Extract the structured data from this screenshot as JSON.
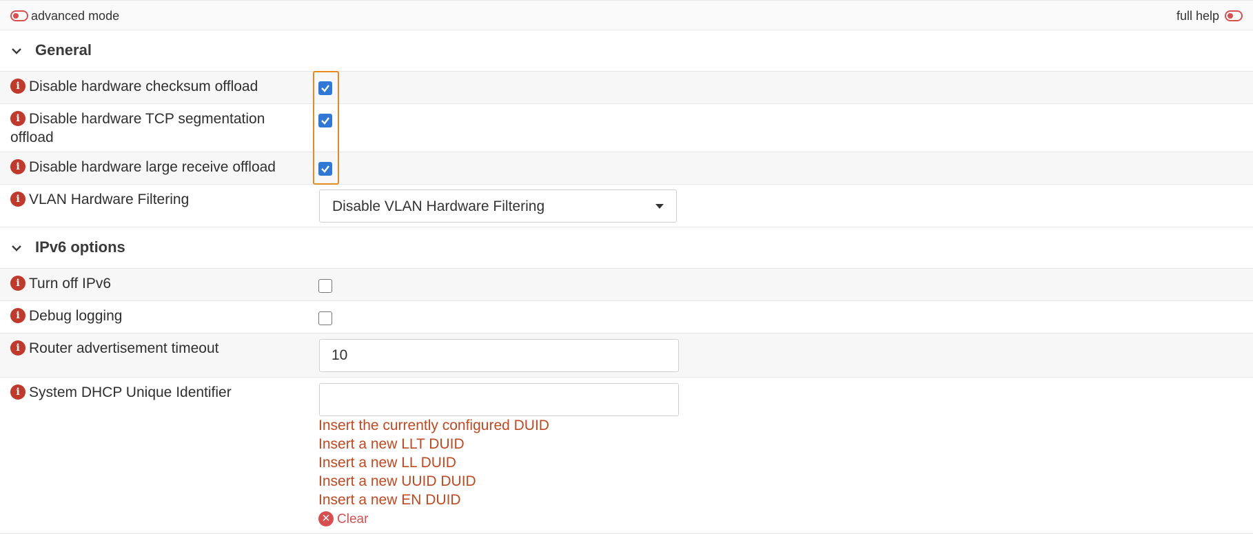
{
  "toolbar": {
    "advanced_mode_label": "advanced mode",
    "full_help_label": "full help"
  },
  "sections": {
    "general": {
      "title": "General",
      "rows": {
        "checksum": {
          "label": "Disable hardware checksum offload",
          "checked": true
        },
        "tcp_seg": {
          "label": "Disable hardware TCP segmentation offload",
          "checked": true
        },
        "lro": {
          "label": "Disable hardware large receive offload",
          "checked": true
        },
        "vlan": {
          "label": "VLAN Hardware Filtering",
          "selected": "Disable VLAN Hardware Filtering"
        }
      }
    },
    "ipv6": {
      "title": "IPv6 options",
      "rows": {
        "turn_off": {
          "label": "Turn off IPv6",
          "checked": false
        },
        "debug": {
          "label": "Debug logging",
          "checked": false
        },
        "ra_timeout": {
          "label": "Router advertisement timeout",
          "value": "10"
        },
        "duid": {
          "label": "System DHCP Unique Identifier",
          "value": "",
          "links": {
            "current": "Insert the currently configured DUID",
            "llt": "Insert a new LLT DUID",
            "ll": "Insert a new LL DUID",
            "uuid": "Insert a new UUID DUID",
            "en": "Insert a new EN DUID"
          },
          "clear_label": "Clear"
        }
      }
    }
  },
  "colors": {
    "accent_red": "#c0392b",
    "link": "#c2481f",
    "checkbox": "#2f78d6",
    "highlight": "#e38b22"
  }
}
